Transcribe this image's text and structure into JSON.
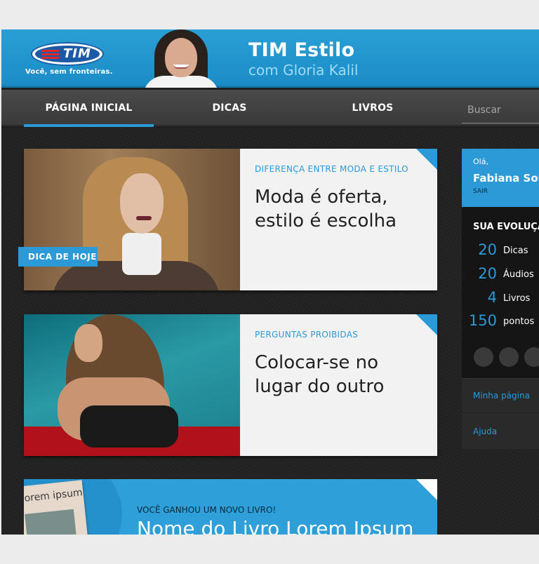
{
  "header": {
    "logo_text": "TIM",
    "tagline": "Você, sem fronteiras.",
    "title": "TIM Estilo",
    "subtitle": "com Gloria Kalil"
  },
  "nav": {
    "items": [
      {
        "label": "PÁGINA INICIAL",
        "active": true
      },
      {
        "label": "DICAS",
        "active": false
      },
      {
        "label": "LIVROS",
        "active": false
      }
    ],
    "search_placeholder": "Buscar"
  },
  "cards": [
    {
      "category": "DIFERENÇA ENTRE MODA E ESTILO",
      "title": "Moda é oferta, estilo é escolha",
      "badge": "DICA DE HOJE"
    },
    {
      "category": "PERGUNTAS PROIBIDAS",
      "title": "Colocar-se no lugar do outro"
    }
  ],
  "book_card": {
    "book_cover_text": "lorem ipsum",
    "category": "VOCÊ GANHOU UM NOVO LIVRO!",
    "title": "Nome do Livro Lorem Ipsum"
  },
  "sidebar": {
    "greeting": "Olá,",
    "user_name": "Fabiana Souza",
    "logout": "SAIR",
    "evolution_title": "SUA EVOLUÇÃO",
    "stats": [
      {
        "value": "20",
        "label": "Dicas"
      },
      {
        "value": "20",
        "label": "Áudios"
      },
      {
        "value": "4",
        "label": "Livros"
      },
      {
        "value": "150",
        "label": "pontos"
      }
    ],
    "links": [
      {
        "label": "Minha página"
      },
      {
        "label": "Ajuda"
      }
    ]
  },
  "colors": {
    "accent": "#2b9ad6",
    "header_blue": "#1c8cc6",
    "nav_bg": "#3a3a3a",
    "page_bg": "#222222"
  }
}
